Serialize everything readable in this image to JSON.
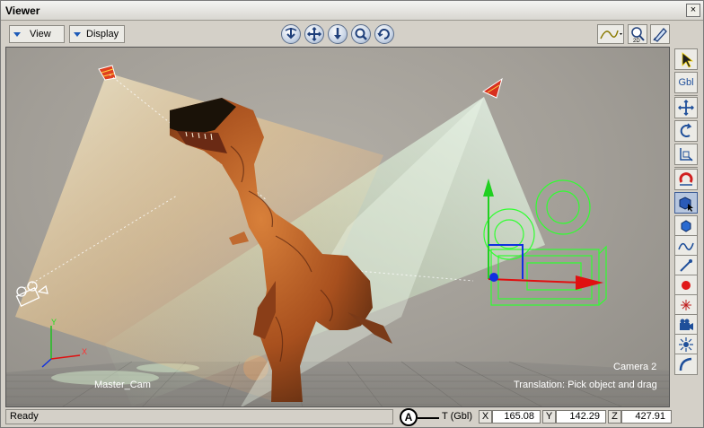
{
  "window": {
    "title": "Viewer",
    "close_glyph": "×"
  },
  "toolbar": {
    "view_label": "View",
    "display_label": "Display",
    "nav_icons": [
      "orbit-icon",
      "pan-icon",
      "dolly-icon",
      "zoom-icon",
      "roll-icon"
    ],
    "right_icons": [
      "curve-icon",
      "zoom-2d-icon",
      "pen-icon"
    ]
  },
  "viewport": {
    "scene_camera_label": "Master_Cam",
    "camera_name": "Camera 2",
    "tool_hint": "Translation: Pick object and drag",
    "axis_x": "X",
    "axis_y": "Y"
  },
  "side_toolbar": {
    "gbl_label": "Gbl"
  },
  "status": {
    "text": "Ready",
    "callout": "A",
    "mode": "T (Gbl)",
    "x_label": "X",
    "x_value": "165.08",
    "y_label": "Y",
    "y_value": "142.29",
    "z_label": "Z",
    "z_value": "427.91"
  },
  "colors": {
    "accent": "#1e5bb8",
    "x_axis": "#e01010",
    "y_axis": "#10c010",
    "z_axis": "#1030e0",
    "manipulator": "#30ff30"
  }
}
